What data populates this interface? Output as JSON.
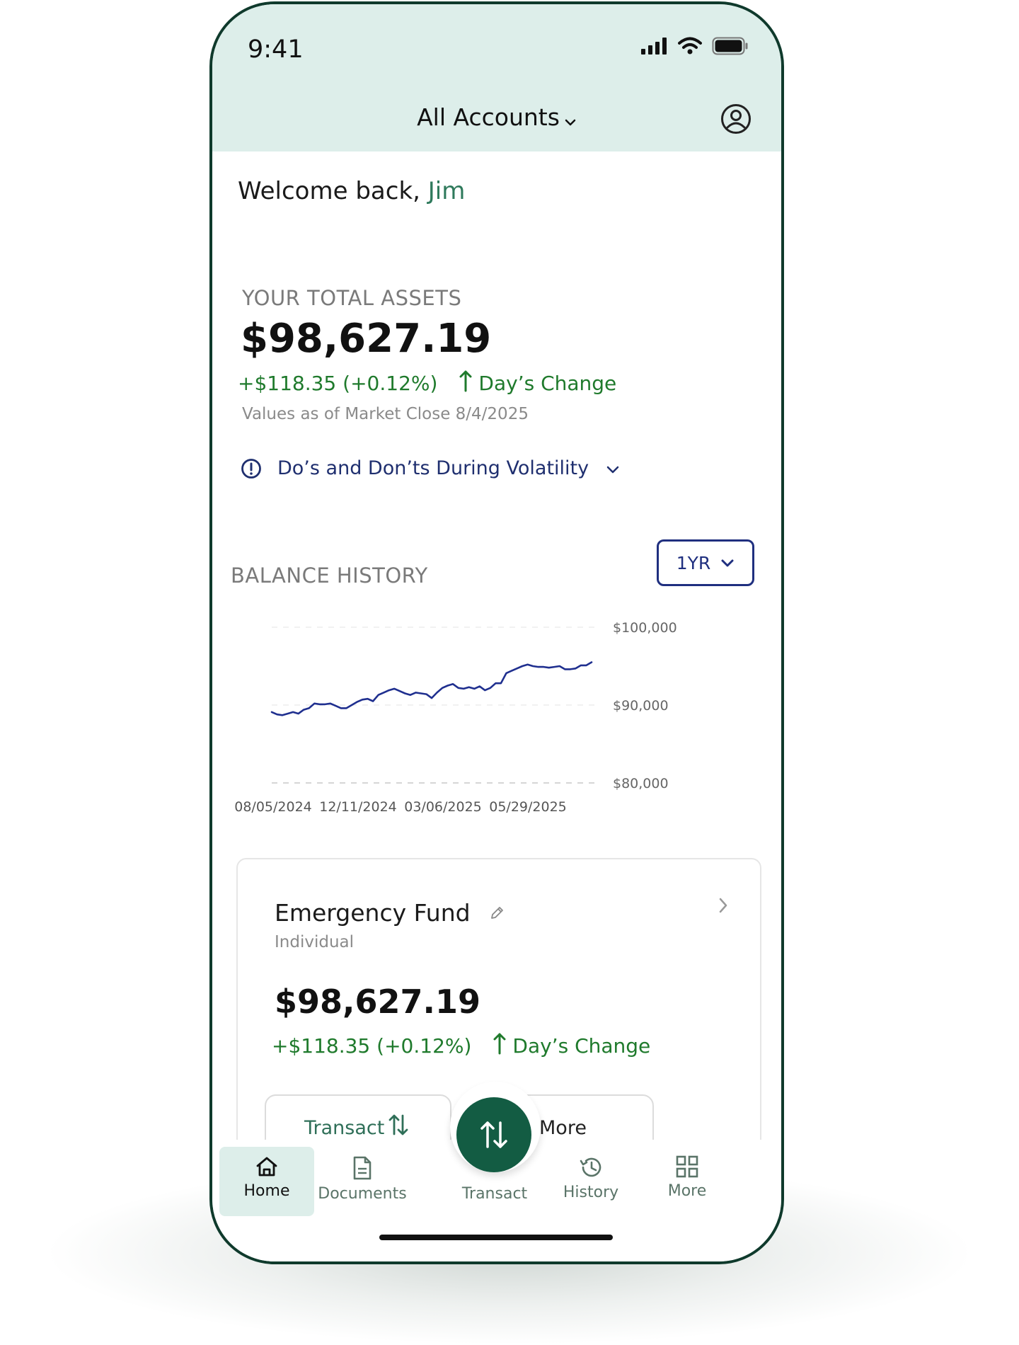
{
  "status_bar": {
    "time": "9:41"
  },
  "header": {
    "account_selector": "All Accounts"
  },
  "welcome": {
    "prefix": "Welcome back, ",
    "name": "Jim"
  },
  "total_assets": {
    "label": "YOUR TOTAL ASSETS",
    "value": "$98,627.19",
    "change": "+$118.35 (+0.12%)",
    "change_label": "Day’s Change",
    "as_of": "Values as of Market Close 8/4/2025"
  },
  "volatility_banner": {
    "text": "Do’s and Don’ts During Volatility"
  },
  "balance_history": {
    "label": "BALANCE HISTORY",
    "range": "1YR",
    "y_ticks": [
      "$100,000",
      "$90,000",
      "$80,000"
    ],
    "x_ticks": [
      "08/05/2024",
      "12/11/2024",
      "03/06/2025",
      "05/29/2025"
    ]
  },
  "chart_data": {
    "type": "line",
    "title": "",
    "xlabel": "",
    "ylabel": "",
    "ylim": [
      80000,
      100000
    ],
    "y_ticks": [
      80000,
      90000,
      100000
    ],
    "x_tick_labels": [
      "08/05/2024",
      "12/11/2024",
      "03/06/2025",
      "05/29/2025"
    ],
    "grid": true,
    "line_color": "#1f2f8f",
    "values": [
      89100,
      88800,
      88700,
      88900,
      89100,
      88900,
      89400,
      89600,
      90200,
      90100,
      90100,
      90200,
      89900,
      89600,
      89600,
      90000,
      90400,
      90700,
      90800,
      90500,
      91300,
      91600,
      91900,
      92100,
      91800,
      91500,
      91300,
      91600,
      91500,
      91400,
      90900,
      91600,
      92200,
      92500,
      92700,
      92200,
      92100,
      92300,
      92100,
      92400,
      91900,
      92200,
      92800,
      92800,
      94100,
      94400,
      94700,
      95000,
      95200,
      95000,
      94900,
      94900,
      94800,
      94900,
      95000,
      94600,
      94600,
      94700,
      95100,
      95100,
      95500
    ]
  },
  "account_card": {
    "name": "Emergency Fund",
    "type": "Individual",
    "value": "$98,627.19",
    "change": "+$118.35 (+0.12%)",
    "change_label": "Day’s Change",
    "transact_label": "Transact",
    "more_label": "More"
  },
  "tab_bar": {
    "home": "Home",
    "documents": "Documents",
    "transact": "Transact",
    "history": "History",
    "more": "More"
  },
  "colors": {
    "brand_green": "#135c43",
    "header_bg": "#ddeeea",
    "positive": "#1f7a2c",
    "link_navy": "#1f2f6f"
  },
  "icons": [
    "signal-icon",
    "wifi-icon",
    "battery-icon",
    "profile-icon",
    "alert-icon",
    "pencil-icon",
    "chevron-right-icon",
    "transfer-icon",
    "home-icon",
    "document-icon",
    "history-icon",
    "grid-icon"
  ]
}
